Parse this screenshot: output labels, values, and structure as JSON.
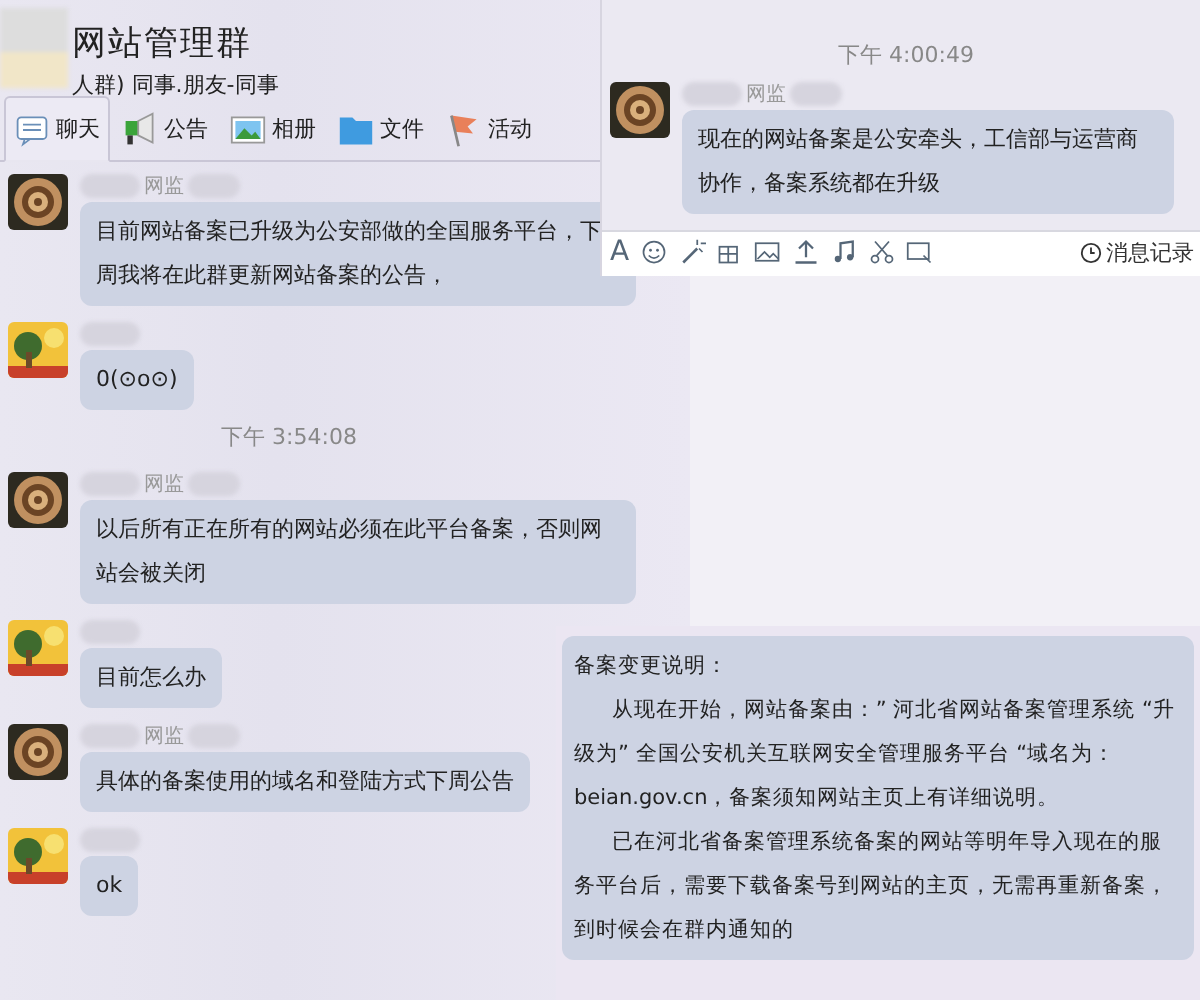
{
  "group": {
    "title": "网站管理群",
    "subtitle": "人群) 同事.朋友-同事"
  },
  "tabs": [
    {
      "label": "聊天",
      "selected": true
    },
    {
      "label": "公告",
      "selected": false
    },
    {
      "label": "相册",
      "selected": false
    },
    {
      "label": "文件",
      "selected": false
    },
    {
      "label": "活动",
      "selected": false
    }
  ],
  "messages": [
    {
      "kind": "official",
      "sender": "网监",
      "text": "目前网站备案已升级为公安部做的全国服务平台，下周我将在此群更新网站备案的公告，"
    },
    {
      "kind": "member",
      "text": "0(⊙o⊙)"
    },
    {
      "kind": "time",
      "text": "下午 3:54:08"
    },
    {
      "kind": "official",
      "sender": "网监",
      "text": "以后所有正在所有的网站必须在此平台备案，否则网站会被关闭"
    },
    {
      "kind": "member",
      "text": "目前怎么办"
    },
    {
      "kind": "official",
      "sender": "网监",
      "text": "具体的备案使用的域名和登陆方式下周公告"
    },
    {
      "kind": "member",
      "text": "ok"
    }
  ],
  "second_window": {
    "messages": [
      {
        "kind": "time",
        "text": "下午 4:00:49"
      },
      {
        "kind": "official",
        "sender": "网监",
        "text": "现在的网站备案是公安牵头，工信部与运营商协作，备案系统都在升级"
      }
    ],
    "toolbar": {
      "history_label": "消息记录",
      "font_label": "A"
    }
  },
  "notice": {
    "paragraphs": [
      {
        "kind": "heading",
        "text": "备案变更说明："
      },
      {
        "kind": "indented",
        "text": "从现在开始，网站备案由：” 河北省网站备案管理系统 “升级为” 全国公安机关互联网安全管理服务平台 “域名为：beian.gov.cn，备案须知网站主页上有详细说明。"
      },
      {
        "kind": "indented",
        "text": "已在河北省备案管理系统备案的网站等明年导入现在的服务平台后，需要下载备案号到网站的主页，无需再重新备案，到时候会在群内通知的"
      }
    ]
  }
}
